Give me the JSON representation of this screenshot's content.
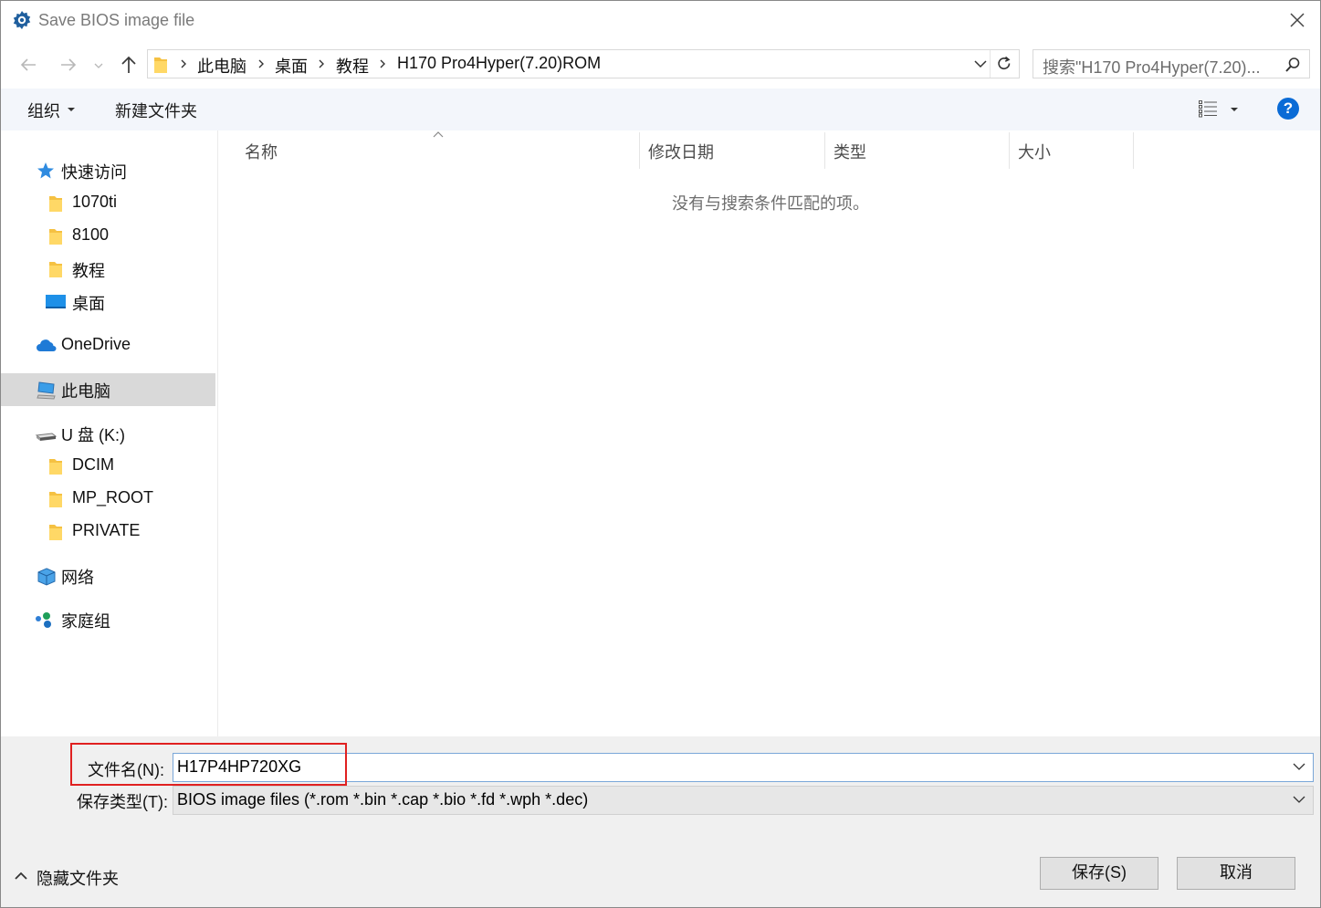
{
  "window": {
    "title": "Save BIOS image file"
  },
  "address": {
    "breadcrumbs": [
      "此电脑",
      "桌面",
      "教程",
      "H170 Pro4Hyper(7.20)ROM"
    ]
  },
  "search": {
    "placeholder": "搜索\"H170 Pro4Hyper(7.20)..."
  },
  "toolbar": {
    "organize_label": "组织",
    "new_folder_label": "新建文件夹",
    "help_label": "?"
  },
  "nav": {
    "quick_access": "快速访问",
    "quick_items": [
      "1070ti",
      "8100",
      "教程",
      "桌面"
    ],
    "onedrive": "OneDrive",
    "this_pc": "此电脑",
    "usb_drive": "U 盘 (K:)",
    "usb_items": [
      "DCIM",
      "MP_ROOT",
      "PRIVATE"
    ],
    "network": "网络",
    "homegroup": "家庭组"
  },
  "filelist": {
    "columns": [
      "名称",
      "修改日期",
      "类型",
      "大小"
    ],
    "empty_message": "没有与搜索条件匹配的项。"
  },
  "bottom": {
    "filename_label": "文件名(N):",
    "filename_value": "H17P4HP720XG",
    "filetype_label": "保存类型(T):",
    "filetype_value": "BIOS image files (*.rom *.bin *.cap *.bio *.fd *.wph *.dec)",
    "hide_folders_label": "隐藏文件夹",
    "save_label": "保存(S)",
    "cancel_label": "取消"
  },
  "colors": {
    "accent": "#0a6bd6",
    "highlight_box": "#e02020",
    "selected_nav": "#d9d9d9"
  }
}
